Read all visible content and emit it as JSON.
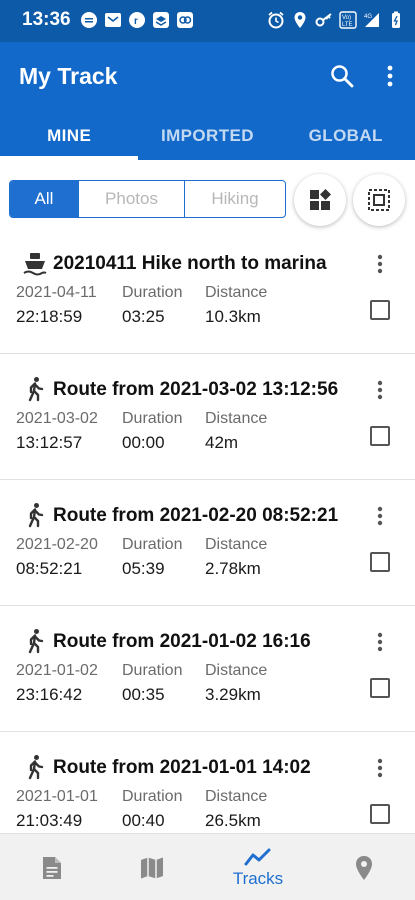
{
  "status_bar": {
    "time": "13:36",
    "network": "4G",
    "volte": "Vo) LTE"
  },
  "app": {
    "title": "My Track",
    "accent": "#1269c9",
    "statusbar_color": "#0d5aa8",
    "icons": {
      "search": "search-icon",
      "more": "more-vert-icon"
    }
  },
  "tabs": [
    {
      "label": "MINE",
      "active": true
    },
    {
      "label": "IMPORTED",
      "active": false
    },
    {
      "label": "GLOBAL",
      "active": false
    }
  ],
  "filters": {
    "segments": [
      {
        "label": "All",
        "selected": true
      },
      {
        "label": "Photos",
        "selected": false
      },
      {
        "label": "Hiking",
        "selected": false
      }
    ],
    "buttons": [
      "view-mode-icon",
      "select-all-icon"
    ]
  },
  "tracks": [
    {
      "icon": "ferry-icon",
      "name": "20210411 Hike north to marina",
      "date": "2021-04-11",
      "time": "22:18:59",
      "duration_label": "Duration",
      "duration": "03:25",
      "distance_label": "Distance",
      "distance": "10.3km"
    },
    {
      "icon": "walk-icon",
      "name": "Route from 2021-03-02 13:12:56",
      "date": "2021-03-02",
      "time": "13:12:57",
      "duration_label": "Duration",
      "duration": "00:00",
      "distance_label": "Distance",
      "distance": "42m"
    },
    {
      "icon": "walk-icon",
      "name": "Route from 2021-02-20 08:52:21",
      "date": "2021-02-20",
      "time": "08:52:21",
      "duration_label": "Duration",
      "duration": "05:39",
      "distance_label": "Distance",
      "distance": "2.78km"
    },
    {
      "icon": "walk-icon",
      "name": "Route from 2021-01-02 16:16",
      "date": "2021-01-02",
      "time": "23:16:42",
      "duration_label": "Duration",
      "duration": "00:35",
      "distance_label": "Distance",
      "distance": "3.29km"
    },
    {
      "icon": "walk-icon",
      "name": "Route from 2021-01-01 14:02",
      "date": "2021-01-01",
      "time": "21:03:49",
      "duration_label": "Duration",
      "duration": "00:40",
      "distance_label": "Distance",
      "distance": "26.5km"
    }
  ],
  "bottom_nav": [
    {
      "icon": "document-icon",
      "label": "",
      "active": false
    },
    {
      "icon": "map-icon",
      "label": "",
      "active": false
    },
    {
      "icon": "tracks-icon",
      "label": "Tracks",
      "active": true
    },
    {
      "icon": "location-pin-icon",
      "label": "",
      "active": false
    }
  ]
}
